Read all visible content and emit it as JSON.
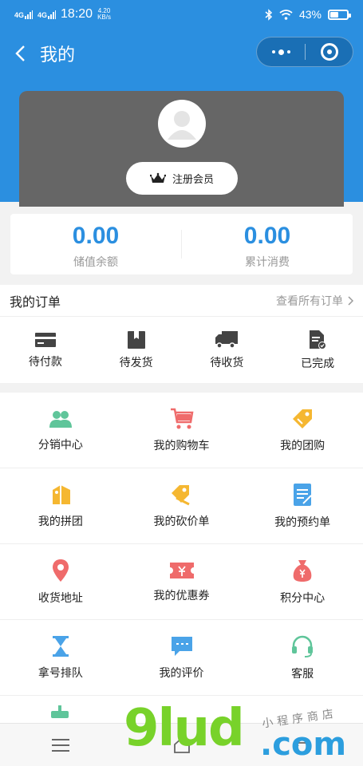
{
  "status_bar": {
    "network_1": "4G",
    "network_2": "4G",
    "time": "18:20",
    "speed_value": "4.20",
    "speed_unit": "KB/s",
    "battery": "43%",
    "icons": [
      "bluetooth-icon",
      "wifi-icon",
      "battery-icon"
    ]
  },
  "nav": {
    "title": "我的",
    "back_icon": "back-arrow-icon",
    "capsule_icons": [
      "more-dots-icon",
      "close-circle-icon"
    ]
  },
  "profile": {
    "register_label": "注册会员",
    "avatar_icon": "default-avatar-icon",
    "crown_icon": "crown-icon"
  },
  "balance": [
    {
      "value": "0.00",
      "label": "储值余额"
    },
    {
      "value": "0.00",
      "label": "累计消费"
    }
  ],
  "orders": {
    "title": "我的订单",
    "view_all": "查看所有订单",
    "items": [
      {
        "label": "待付款",
        "icon": "card-icon"
      },
      {
        "label": "待发货",
        "icon": "box-icon"
      },
      {
        "label": "待收货",
        "icon": "truck-icon"
      },
      {
        "label": "已完成",
        "icon": "document-check-icon"
      }
    ]
  },
  "menu": [
    {
      "label": "分销中心",
      "icon": "users-icon",
      "color": "#5fc59a"
    },
    {
      "label": "我的购物车",
      "icon": "cart-icon",
      "color": "#ef6b6b"
    },
    {
      "label": "我的团购",
      "icon": "tag-icon",
      "color": "#f5b731"
    },
    {
      "label": "我的拼团",
      "icon": "group-tag-icon",
      "color": "#f5b731"
    },
    {
      "label": "我的砍价单",
      "icon": "price-tag-icon",
      "color": "#f5b731"
    },
    {
      "label": "我的预约单",
      "icon": "notebook-icon",
      "color": "#4aa3e8"
    },
    {
      "label": "收货地址",
      "icon": "location-pin-icon",
      "color": "#ef6b6b"
    },
    {
      "label": "我的优惠券",
      "icon": "coupon-icon",
      "color": "#ef6b6b"
    },
    {
      "label": "积分中心",
      "icon": "money-bag-icon",
      "color": "#ef6b6b"
    },
    {
      "label": "拿号排队",
      "icon": "hourglass-icon",
      "color": "#4aa3e8"
    },
    {
      "label": "我的评价",
      "icon": "chat-bubble-icon",
      "color": "#4aa3e8"
    },
    {
      "label": "客服",
      "icon": "headset-icon",
      "color": "#5fc59a"
    }
  ],
  "bottom_bar": [
    "menu-lines-icon",
    "home-icon",
    "back-icon"
  ],
  "watermark": {
    "logo": "9lud",
    "domain": ".com",
    "sub": "小程序商店"
  },
  "colors": {
    "primary": "#2b8fe0",
    "card_gray": "#666666",
    "green": "#5fc59a",
    "red": "#ef6b6b",
    "yellow": "#f5b731"
  }
}
